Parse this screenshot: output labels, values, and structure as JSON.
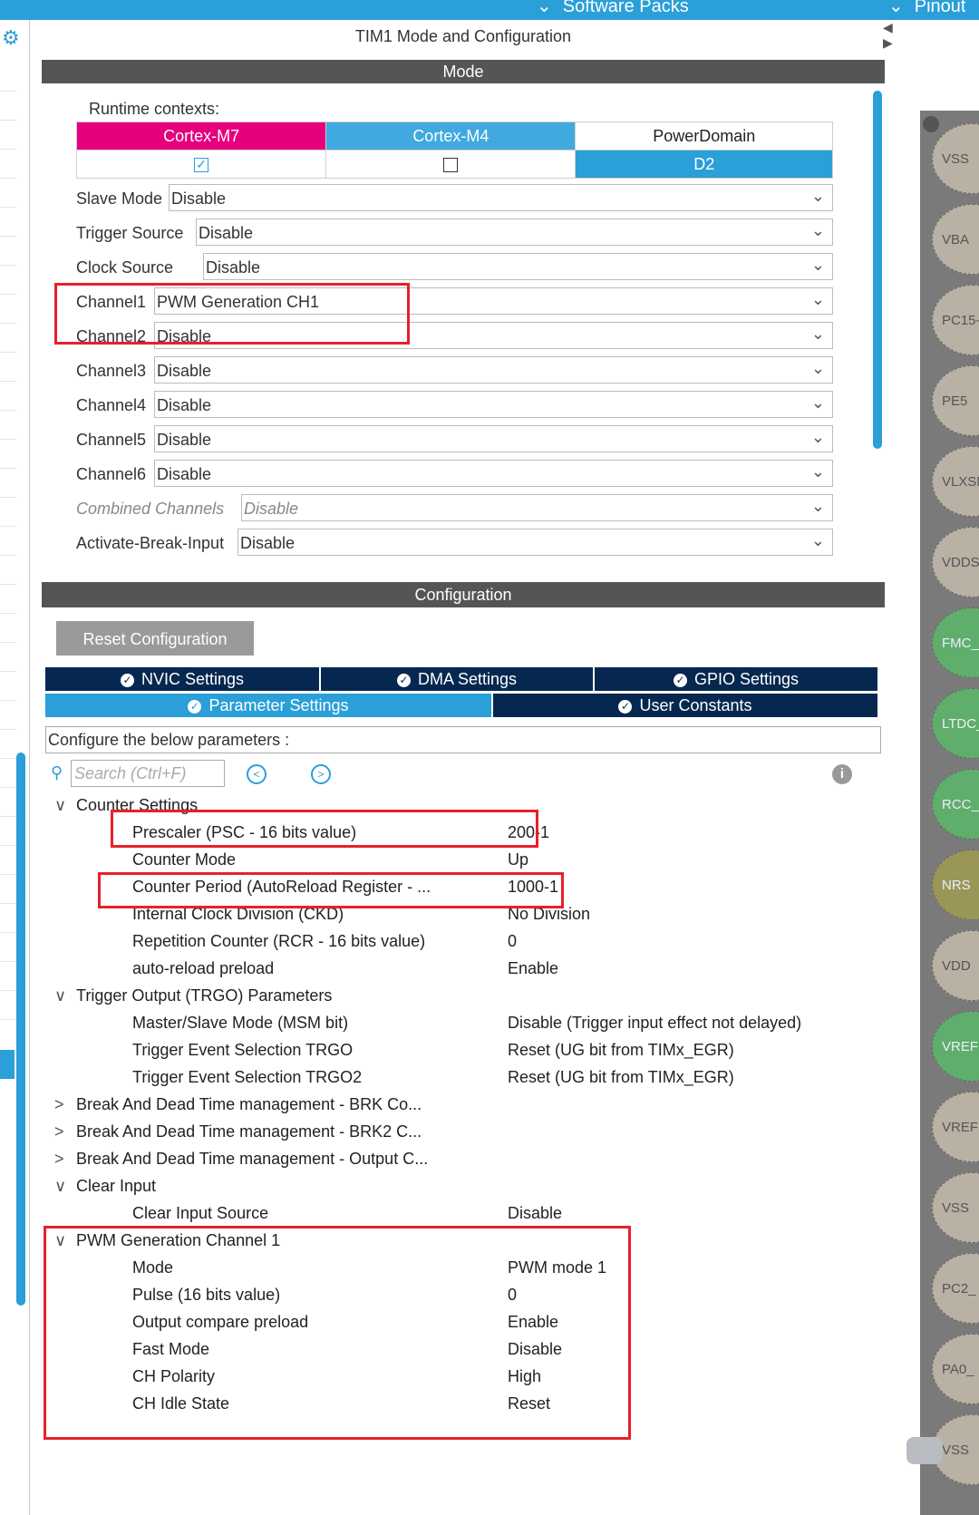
{
  "topbar": {
    "nav_software_packs": "Software Packs",
    "nav_pinout": "Pinout"
  },
  "panel": {
    "title": "TIM1 Mode and Configuration",
    "mode_header": "Mode",
    "config_header": "Configuration"
  },
  "runtime": {
    "label": "Runtime contexts:",
    "contexts": [
      {
        "name": "Cortex-M7",
        "checked": true
      },
      {
        "name": "Cortex-M4",
        "checked": false
      }
    ],
    "power_domain_label": "PowerDomain",
    "power_domain_value": "D2"
  },
  "mode_fields": [
    {
      "label": "Slave Mode",
      "value": "Disable"
    },
    {
      "label": "Trigger Source",
      "value": "Disable"
    },
    {
      "label": "Clock Source",
      "value": "Disable"
    },
    {
      "label": "Channel1",
      "value": "PWM Generation CH1"
    },
    {
      "label": "Channel2",
      "value": "Disable"
    },
    {
      "label": "Channel3",
      "value": "Disable"
    },
    {
      "label": "Channel4",
      "value": "Disable"
    },
    {
      "label": "Channel5",
      "value": "Disable"
    },
    {
      "label": "Channel6",
      "value": "Disable"
    },
    {
      "label": "Combined Channels",
      "value": "Disable"
    },
    {
      "label": "Activate-Break-Input",
      "value": "Disable"
    }
  ],
  "config": {
    "reset_button": "Reset Configuration",
    "tabs_row1": [
      "NVIC Settings",
      "DMA Settings",
      "GPIO Settings"
    ],
    "tabs_row2": [
      "Parameter Settings",
      "User Constants"
    ],
    "active_tab": "Parameter Settings",
    "hint": "Configure the below parameters :",
    "search_placeholder": "Search (Ctrl+F)"
  },
  "parameters": [
    {
      "type": "group",
      "label": "Counter Settings",
      "expanded": true
    },
    {
      "type": "item",
      "label": "Prescaler (PSC - 16 bits value)",
      "value": "200-1"
    },
    {
      "type": "item",
      "label": "Counter Mode",
      "value": "Up"
    },
    {
      "type": "item",
      "label": "Counter Period (AutoReload Register - ...",
      "value": "1000-1"
    },
    {
      "type": "item",
      "label": "Internal Clock Division (CKD)",
      "value": "No Division"
    },
    {
      "type": "item",
      "label": "Repetition Counter (RCR - 16 bits value)",
      "value": "0"
    },
    {
      "type": "item",
      "label": "auto-reload preload",
      "value": "Enable"
    },
    {
      "type": "group",
      "label": "Trigger Output (TRGO) Parameters",
      "expanded": true
    },
    {
      "type": "item",
      "label": "Master/Slave Mode (MSM bit)",
      "value": "Disable (Trigger input effect not delayed)"
    },
    {
      "type": "item",
      "label": "Trigger Event Selection TRGO",
      "value": "Reset (UG bit from TIMx_EGR)"
    },
    {
      "type": "item",
      "label": "Trigger Event Selection TRGO2",
      "value": "Reset (UG bit from TIMx_EGR)"
    },
    {
      "type": "group",
      "label": "Break And Dead Time management - BRK Co...",
      "expanded": false
    },
    {
      "type": "group",
      "label": "Break And Dead Time management - BRK2 C...",
      "expanded": false
    },
    {
      "type": "group",
      "label": "Break And Dead Time management - Output C...",
      "expanded": false
    },
    {
      "type": "group",
      "label": "Clear Input",
      "expanded": true
    },
    {
      "type": "item",
      "label": "Clear Input Source",
      "value": "Disable"
    },
    {
      "type": "group",
      "label": "PWM Generation Channel 1",
      "expanded": true
    },
    {
      "type": "item",
      "label": "Mode",
      "value": "PWM mode 1"
    },
    {
      "type": "item",
      "label": "Pulse (16 bits value)",
      "value": "0"
    },
    {
      "type": "item",
      "label": "Output compare preload",
      "value": "Enable"
    },
    {
      "type": "item",
      "label": "Fast Mode",
      "value": "Disable"
    },
    {
      "type": "item",
      "label": "CH Polarity",
      "value": "High"
    },
    {
      "type": "item",
      "label": "CH Idle State",
      "value": "Reset"
    }
  ],
  "pins": [
    {
      "label": "VSS",
      "color": "#b8b1a4"
    },
    {
      "label": "VBA",
      "color": "#b8b1a4"
    },
    {
      "label": "PC15-",
      "color": "#b8b1a4"
    },
    {
      "label": "PE5",
      "color": "#b8b1a4"
    },
    {
      "label": "VLXSM",
      "color": "#b8b1a4"
    },
    {
      "label": "VDDSM",
      "color": "#b8b1a4"
    },
    {
      "label": "FMC_",
      "color": "#5fae6b"
    },
    {
      "label": "LTDC_",
      "color": "#5fae6b"
    },
    {
      "label": "RCC_C",
      "color": "#5fae6b"
    },
    {
      "label": "NRS",
      "color": "#9a9658"
    },
    {
      "label": "VDD",
      "color": "#b8b1a4"
    },
    {
      "label": "VREF",
      "color": "#5fae6b"
    },
    {
      "label": "VREF",
      "color": "#b8b1a4"
    },
    {
      "label": "VSS",
      "color": "#b8b1a4"
    },
    {
      "label": "PC2_",
      "color": "#b8b1a4"
    },
    {
      "label": "PA0_",
      "color": "#b8b1a4"
    },
    {
      "label": "VSS",
      "color": "#b8b1a4"
    }
  ],
  "colors": {
    "accent": "#2a9fd8",
    "cortex_m7": "#e6007e",
    "tab_dark": "#062850",
    "highlight": "#e8202a"
  }
}
